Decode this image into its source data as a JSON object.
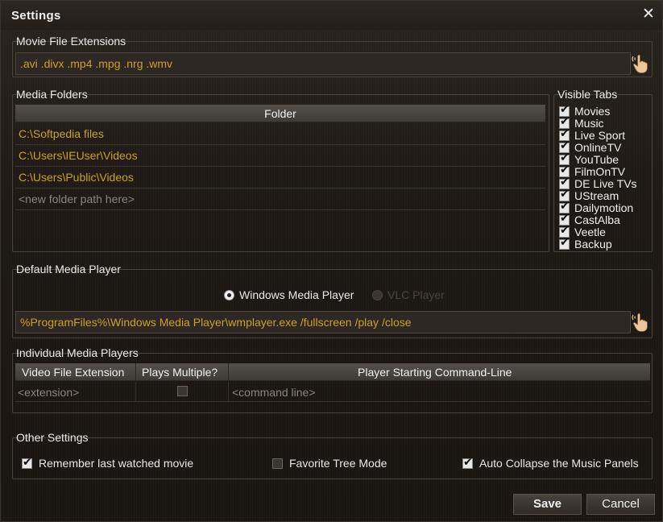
{
  "window": {
    "title": "Settings",
    "close_glyph": "✕"
  },
  "extensions": {
    "group_label": "Movie File Extensions",
    "value": ".avi .divx .mp4 .mpg .nrg .wmv",
    "picker_icon": "hand-pointer-icon"
  },
  "media_folders": {
    "group_label": "Media Folders",
    "column_header": "Folder",
    "rows": [
      {
        "path": "C:\\Softpedia files"
      },
      {
        "path": "C:\\Users\\IEUser\\Videos"
      },
      {
        "path": "C:\\Users\\Public\\Videos"
      }
    ],
    "new_row_placeholder": "<new folder path here>"
  },
  "visible_tabs": {
    "group_label": "Visible Tabs",
    "items": [
      {
        "label": "Movies",
        "checked": true
      },
      {
        "label": "Music",
        "checked": true
      },
      {
        "label": "Live Sport",
        "checked": true
      },
      {
        "label": "OnlineTV",
        "checked": true
      },
      {
        "label": "YouTube",
        "checked": true
      },
      {
        "label": "FilmOnTV",
        "checked": true
      },
      {
        "label": "DE Live TVs",
        "checked": true
      },
      {
        "label": "UStream",
        "checked": true
      },
      {
        "label": "Dailymotion",
        "checked": true
      },
      {
        "label": "CastAlba",
        "checked": true
      },
      {
        "label": "Veetle",
        "checked": true
      },
      {
        "label": "Backup",
        "checked": true
      }
    ]
  },
  "default_player": {
    "group_label": "Default Media Player",
    "options": [
      {
        "label": "Windows Media Player",
        "selected": true,
        "enabled": true
      },
      {
        "label": "VLC Player",
        "selected": false,
        "enabled": false
      }
    ],
    "command": "%ProgramFiles%\\Windows Media Player\\wmplayer.exe /fullscreen /play /close"
  },
  "individual_players": {
    "group_label": "Individual Media Players",
    "columns": [
      "Video File Extension",
      "Plays Multiple?",
      "Player Starting Command-Line"
    ],
    "placeholder_row": {
      "extension": "<extension>",
      "plays_multiple": false,
      "command": "<command line>"
    }
  },
  "other_settings": {
    "group_label": "Other Settings",
    "remember_last": {
      "label": "Remember last watched movie",
      "checked": true
    },
    "favorite_tree": {
      "label": "Favorite Tree Mode",
      "checked": false
    },
    "auto_collapse": {
      "label": "Auto Collapse the Music Panels",
      "checked": true
    }
  },
  "buttons": {
    "save": "Save",
    "cancel": "Cancel"
  },
  "colors": {
    "accent_text": "#c9a227",
    "background": "#1d1813"
  }
}
